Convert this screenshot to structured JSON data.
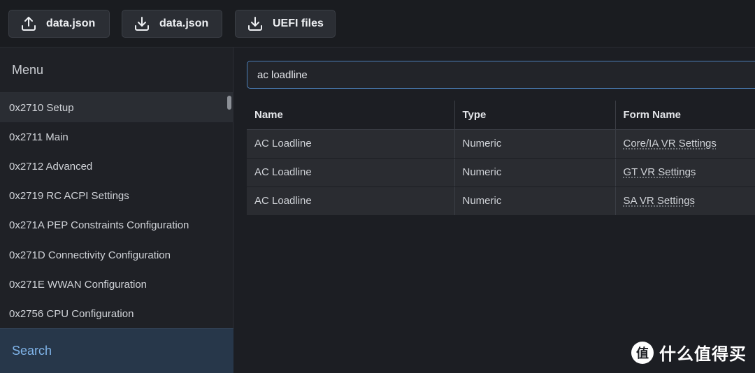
{
  "toolbar": {
    "buttons": [
      {
        "label": "data.json",
        "icon": "upload-icon"
      },
      {
        "label": "data.json",
        "icon": "download-icon"
      },
      {
        "label": "UEFI files",
        "icon": "download-icon"
      }
    ]
  },
  "sidebar": {
    "title": "Menu",
    "items": [
      {
        "label": "0x2710 Setup",
        "active": true
      },
      {
        "label": "0x2711 Main"
      },
      {
        "label": "0x2712 Advanced"
      },
      {
        "label": "0x2719 RC ACPI Settings"
      },
      {
        "label": "0x271A PEP Constraints Configuration"
      },
      {
        "label": "0x271D Connectivity Configuration"
      },
      {
        "label": "0x271E WWAN Configuration"
      },
      {
        "label": "0x2756 CPU Configuration"
      }
    ],
    "search_label": "Search"
  },
  "main": {
    "search": {
      "value": "ac loadline"
    },
    "table": {
      "headers": [
        "Name",
        "Type",
        "Form Name"
      ],
      "rows": [
        [
          "AC Loadline",
          "Numeric",
          "Core/IA VR Settings"
        ],
        [
          "AC Loadline",
          "Numeric",
          "GT VR Settings"
        ],
        [
          "AC Loadline",
          "Numeric",
          "SA VR Settings"
        ]
      ]
    }
  },
  "watermark": {
    "logo": "值",
    "text": "什么值得买"
  },
  "colors": {
    "accent": "#4c7fb8",
    "search_panel_bg": "#27374a",
    "search_text": "#7fb3e8"
  }
}
